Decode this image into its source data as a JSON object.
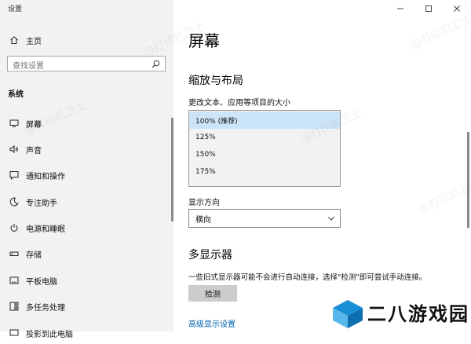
{
  "window": {
    "title": "设置",
    "controls": [
      "minimize-icon",
      "maximize-icon",
      "close-icon"
    ]
  },
  "sidebar": {
    "home_label": "主页",
    "search_placeholder": "查找设置",
    "section_label": "系统",
    "items": [
      {
        "label": "屏幕",
        "icon": "monitor-icon",
        "selected": true
      },
      {
        "label": "声音",
        "icon": "speaker-icon"
      },
      {
        "label": "通知和操作",
        "icon": "notification-icon"
      },
      {
        "label": "专注助手",
        "icon": "moon-icon"
      },
      {
        "label": "电源和睡眠",
        "icon": "power-icon"
      },
      {
        "label": "存储",
        "icon": "storage-icon"
      },
      {
        "label": "平板电脑",
        "icon": "tablet-icon"
      },
      {
        "label": "多任务处理",
        "icon": "multitask-icon"
      },
      {
        "label": "投影到此电脑",
        "icon": "projection-icon"
      }
    ]
  },
  "main": {
    "title": "屏幕",
    "scale_section": {
      "heading": "缩放与布局",
      "label": "更改文本、应用等项目的大小",
      "options": [
        "100% (推荐)",
        "125%",
        "150%",
        "175%"
      ],
      "selected_index": 0
    },
    "orientation": {
      "label": "显示方向",
      "value": "横向"
    },
    "multi_display": {
      "heading": "多显示器",
      "description": "一些旧式显示器可能不会进行自动连接，选择\"检测\"即可尝试手动连接。",
      "detect_button": "检测",
      "advanced_link": "高级显示设置"
    }
  },
  "watermark_text": "@打印机卫士",
  "brand_logo_text": "二八游戏园",
  "colors": {
    "sidebar_bg": "#f2f2f2",
    "selected_option_bg": "#cce4f7",
    "link": "#0063b1",
    "button_bg": "#cccccc",
    "logo_blue": "#1a8fd8"
  }
}
